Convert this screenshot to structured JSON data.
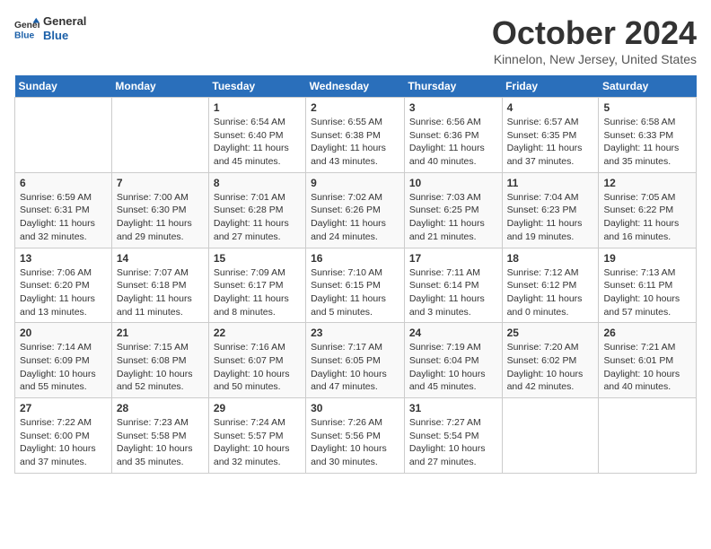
{
  "logo": {
    "line1": "General",
    "line2": "Blue"
  },
  "title": "October 2024",
  "location": "Kinnelon, New Jersey, United States",
  "weekdays": [
    "Sunday",
    "Monday",
    "Tuesday",
    "Wednesday",
    "Thursday",
    "Friday",
    "Saturday"
  ],
  "weeks": [
    [
      {
        "day": "",
        "info": ""
      },
      {
        "day": "",
        "info": ""
      },
      {
        "day": "1",
        "info": "Sunrise: 6:54 AM\nSunset: 6:40 PM\nDaylight: 11 hours and 45 minutes."
      },
      {
        "day": "2",
        "info": "Sunrise: 6:55 AM\nSunset: 6:38 PM\nDaylight: 11 hours and 43 minutes."
      },
      {
        "day": "3",
        "info": "Sunrise: 6:56 AM\nSunset: 6:36 PM\nDaylight: 11 hours and 40 minutes."
      },
      {
        "day": "4",
        "info": "Sunrise: 6:57 AM\nSunset: 6:35 PM\nDaylight: 11 hours and 37 minutes."
      },
      {
        "day": "5",
        "info": "Sunrise: 6:58 AM\nSunset: 6:33 PM\nDaylight: 11 hours and 35 minutes."
      }
    ],
    [
      {
        "day": "6",
        "info": "Sunrise: 6:59 AM\nSunset: 6:31 PM\nDaylight: 11 hours and 32 minutes."
      },
      {
        "day": "7",
        "info": "Sunrise: 7:00 AM\nSunset: 6:30 PM\nDaylight: 11 hours and 29 minutes."
      },
      {
        "day": "8",
        "info": "Sunrise: 7:01 AM\nSunset: 6:28 PM\nDaylight: 11 hours and 27 minutes."
      },
      {
        "day": "9",
        "info": "Sunrise: 7:02 AM\nSunset: 6:26 PM\nDaylight: 11 hours and 24 minutes."
      },
      {
        "day": "10",
        "info": "Sunrise: 7:03 AM\nSunset: 6:25 PM\nDaylight: 11 hours and 21 minutes."
      },
      {
        "day": "11",
        "info": "Sunrise: 7:04 AM\nSunset: 6:23 PM\nDaylight: 11 hours and 19 minutes."
      },
      {
        "day": "12",
        "info": "Sunrise: 7:05 AM\nSunset: 6:22 PM\nDaylight: 11 hours and 16 minutes."
      }
    ],
    [
      {
        "day": "13",
        "info": "Sunrise: 7:06 AM\nSunset: 6:20 PM\nDaylight: 11 hours and 13 minutes."
      },
      {
        "day": "14",
        "info": "Sunrise: 7:07 AM\nSunset: 6:18 PM\nDaylight: 11 hours and 11 minutes."
      },
      {
        "day": "15",
        "info": "Sunrise: 7:09 AM\nSunset: 6:17 PM\nDaylight: 11 hours and 8 minutes."
      },
      {
        "day": "16",
        "info": "Sunrise: 7:10 AM\nSunset: 6:15 PM\nDaylight: 11 hours and 5 minutes."
      },
      {
        "day": "17",
        "info": "Sunrise: 7:11 AM\nSunset: 6:14 PM\nDaylight: 11 hours and 3 minutes."
      },
      {
        "day": "18",
        "info": "Sunrise: 7:12 AM\nSunset: 6:12 PM\nDaylight: 11 hours and 0 minutes."
      },
      {
        "day": "19",
        "info": "Sunrise: 7:13 AM\nSunset: 6:11 PM\nDaylight: 10 hours and 57 minutes."
      }
    ],
    [
      {
        "day": "20",
        "info": "Sunrise: 7:14 AM\nSunset: 6:09 PM\nDaylight: 10 hours and 55 minutes."
      },
      {
        "day": "21",
        "info": "Sunrise: 7:15 AM\nSunset: 6:08 PM\nDaylight: 10 hours and 52 minutes."
      },
      {
        "day": "22",
        "info": "Sunrise: 7:16 AM\nSunset: 6:07 PM\nDaylight: 10 hours and 50 minutes."
      },
      {
        "day": "23",
        "info": "Sunrise: 7:17 AM\nSunset: 6:05 PM\nDaylight: 10 hours and 47 minutes."
      },
      {
        "day": "24",
        "info": "Sunrise: 7:19 AM\nSunset: 6:04 PM\nDaylight: 10 hours and 45 minutes."
      },
      {
        "day": "25",
        "info": "Sunrise: 7:20 AM\nSunset: 6:02 PM\nDaylight: 10 hours and 42 minutes."
      },
      {
        "day": "26",
        "info": "Sunrise: 7:21 AM\nSunset: 6:01 PM\nDaylight: 10 hours and 40 minutes."
      }
    ],
    [
      {
        "day": "27",
        "info": "Sunrise: 7:22 AM\nSunset: 6:00 PM\nDaylight: 10 hours and 37 minutes."
      },
      {
        "day": "28",
        "info": "Sunrise: 7:23 AM\nSunset: 5:58 PM\nDaylight: 10 hours and 35 minutes."
      },
      {
        "day": "29",
        "info": "Sunrise: 7:24 AM\nSunset: 5:57 PM\nDaylight: 10 hours and 32 minutes."
      },
      {
        "day": "30",
        "info": "Sunrise: 7:26 AM\nSunset: 5:56 PM\nDaylight: 10 hours and 30 minutes."
      },
      {
        "day": "31",
        "info": "Sunrise: 7:27 AM\nSunset: 5:54 PM\nDaylight: 10 hours and 27 minutes."
      },
      {
        "day": "",
        "info": ""
      },
      {
        "day": "",
        "info": ""
      }
    ]
  ]
}
